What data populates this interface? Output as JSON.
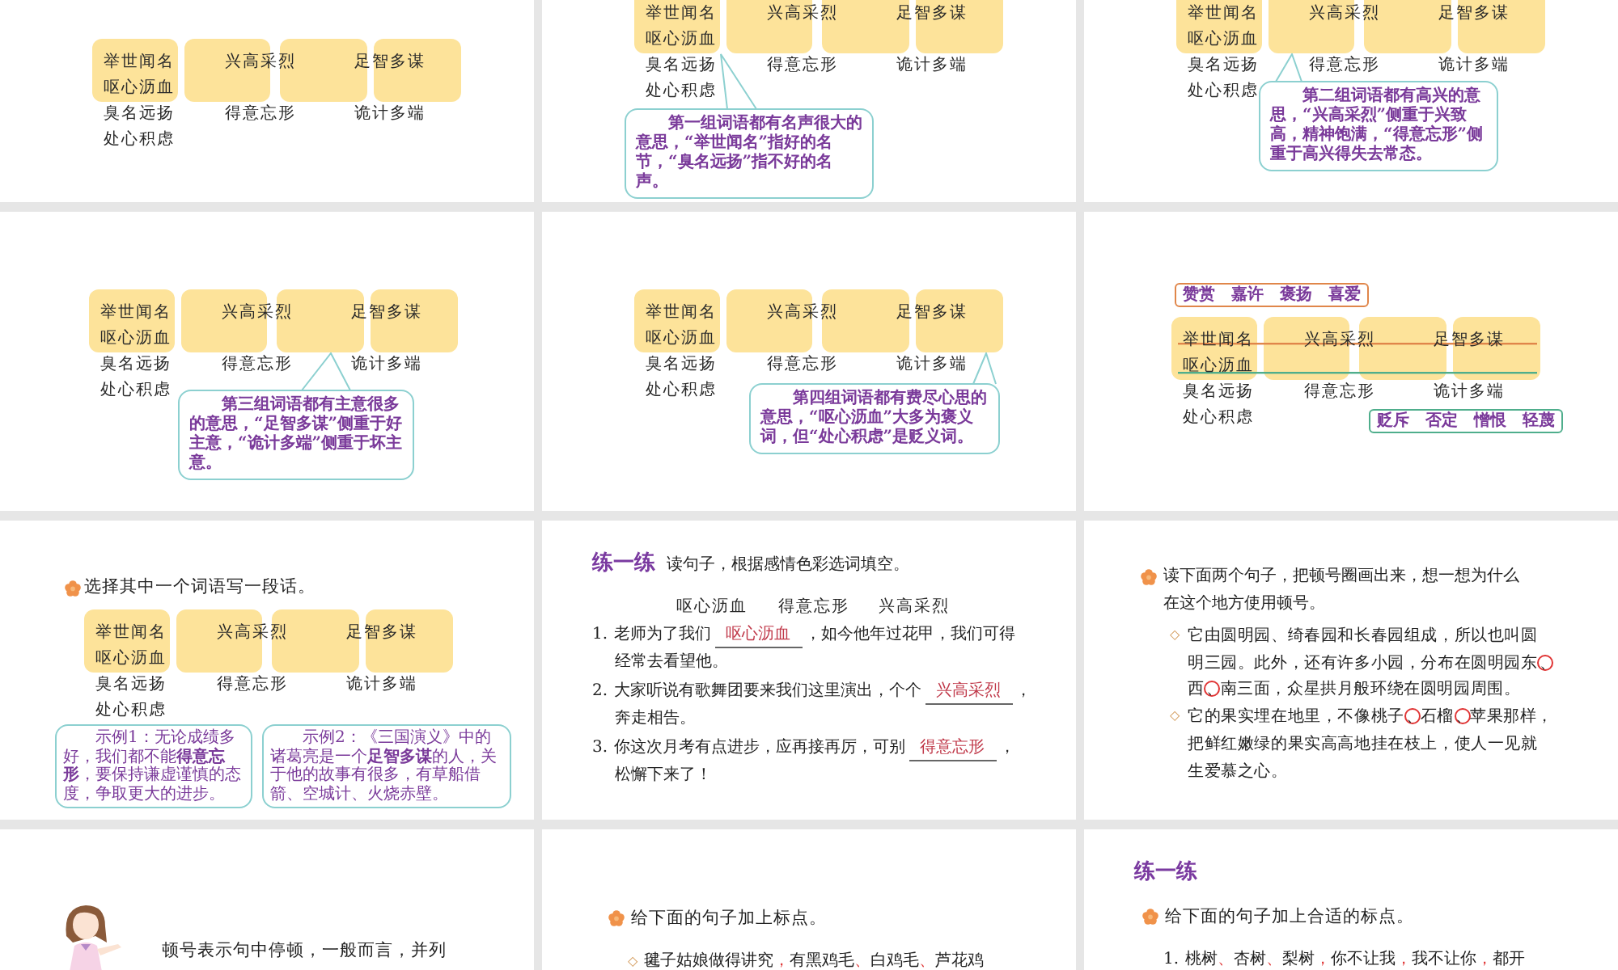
{
  "slides": [
    {
      "kind": "word-board",
      "board": {
        "rows": [
          [
            "举世闻名",
            "兴高采烈",
            "足智多谋"
          ],
          [
            "呕心沥血"
          ],
          [
            "臭名远扬",
            "得意忘形",
            "诡计多端"
          ],
          [
            "处心积虑"
          ]
        ]
      }
    },
    {
      "kind": "word-board",
      "board": {
        "rows": [
          [
            "举世闻名",
            "兴高采烈",
            "足智多谋"
          ],
          [
            "呕心沥血"
          ],
          [
            "臭名远扬",
            "得意忘形",
            "诡计多端"
          ],
          [
            "处心积虑"
          ]
        ]
      },
      "callout": {
        "text": "第一组词语都有名声很大的意思，“举世闻名”指好的名节，“臭名远扬”指不好的名声。"
      }
    },
    {
      "kind": "word-board",
      "board": {
        "rows": [
          [
            "举世闻名",
            "兴高采烈",
            "足智多谋"
          ],
          [
            "呕心沥血"
          ],
          [
            "臭名远扬",
            "得意忘形",
            "诡计多端"
          ],
          [
            "处心积虑"
          ]
        ]
      },
      "callout": {
        "text": "第二组词语都有高兴的意思，“兴高采烈”侧重于兴致高，精神饱满，“得意忘形”侧重于高兴得失去常态。"
      }
    },
    {
      "kind": "word-board",
      "board": {
        "rows": [
          [
            "举世闻名",
            "兴高采烈",
            "足智多谋"
          ],
          [
            "呕心沥血"
          ],
          [
            "臭名远扬",
            "得意忘形",
            "诡计多端"
          ],
          [
            "处心积虑"
          ]
        ]
      },
      "callout": {
        "text": "第三组词语都有主意很多的意思，“足智多谋”侧重于好主意，“诡计多端”侧重于坏主意。"
      }
    },
    {
      "kind": "word-board",
      "board": {
        "rows": [
          [
            "举世闻名",
            "兴高采烈",
            "足智多谋"
          ],
          [
            "呕心沥血"
          ],
          [
            "臭名远扬",
            "得意忘形",
            "诡计多端"
          ],
          [
            "处心积虑"
          ]
        ]
      },
      "callout": {
        "text": "第四组词语都有费尽心思的意思，“呕心沥血”大多为褒义词，但“处心积虑”是贬义词。"
      }
    },
    {
      "kind": "word-board",
      "tags": [
        {
          "text": "赞赏　嘉许　褒扬　喜爱",
          "color": "#e0864a"
        },
        {
          "text": "贬斥　否定　憎恨　轻蔑",
          "color": "#4fae8c"
        }
      ],
      "board": {
        "rows": [
          [
            "举世闻名",
            "兴高采烈",
            "足智多谋"
          ],
          [
            "呕心沥血"
          ],
          [
            "臭名远扬",
            "得意忘形",
            "诡计多端"
          ],
          [
            "处心积虑"
          ]
        ]
      }
    },
    {
      "kind": "word-board",
      "heading": "选择其中一个词语写一段话。",
      "board": {
        "rows": [
          [
            "举世闻名",
            "兴高采烈",
            "足智多谋"
          ],
          [
            "呕心沥血"
          ],
          [
            "臭名远扬",
            "得意忘形",
            "诡计多端"
          ],
          [
            "处心积虑"
          ]
        ]
      },
      "examples": [
        {
          "text": "示例1：无论成绩多好，我们都不能**得意忘形**，要保持谦虚谨慎的态度，争取更大的进步。"
        },
        {
          "text": "示例2：《三国演义》中的诸葛亮是一个**足智多谋**的人，关于他的故事有很多，有草船借箭、空城计、火烧赤壁。"
        }
      ]
    },
    {
      "kind": "fill-blanks",
      "title": "练一练",
      "instruction": "读句子，根据感情色彩选词填空。",
      "choices": [
        "呕心沥血",
        "得意忘形",
        "兴高采烈"
      ],
      "sentences": [
        {
          "number": "1.",
          "before": "老师为了我们",
          "answer": "呕心沥血",
          "after": "，如今他年过花甲，我们可得",
          "continuation": "经常去看望他。"
        },
        {
          "number": "2.",
          "before": "大家听说有歌舞团要来我们这里演出，个个",
          "answer": "兴高采烈",
          "after": "，",
          "continuation": "奔走相告。"
        },
        {
          "number": "3.",
          "before": "你这次月考有点进步，应再接再厉，可别",
          "answer": "得意忘形",
          "after": "，",
          "continuation": "松懈下来了！"
        }
      ]
    },
    {
      "kind": "circle-marks",
      "heading": "读下面两个句子，把顿号圈画出来，想一想为什么在这个地方使用顿号。",
      "items": [
        {
          "marker": "◇",
          "lines": [
            [
              {
                "text": "它由圆明园、绮春园和长春园组成，所以也叫圆",
                "circled": false
              }
            ],
            [
              {
                "text": "明三园。此外，还有许多小园，分布在圆明园东",
                "circled": false
              },
              {
                "text": "、",
                "circled": true
              }
            ],
            [
              {
                "text": "西",
                "circled": false
              },
              {
                "text": "、",
                "circled": true
              },
              {
                "text": "南三面，众星拱月般环绕在圆明园周围。",
                "circled": false
              }
            ]
          ]
        },
        {
          "marker": "◇",
          "lines": [
            [
              {
                "text": "它的果实埋在地里，不像桃子",
                "circled": false
              },
              {
                "text": "、",
                "circled": true
              },
              {
                "text": "石榴",
                "circled": false
              },
              {
                "text": "、",
                "circled": true
              },
              {
                "text": "苹果那样，",
                "circled": false
              }
            ],
            [
              {
                "text": "把鲜红嫩绿的果实高高地挂在枝上，使人一见就",
                "circled": false
              }
            ],
            [
              {
                "text": "生爱慕之心。",
                "circled": false
              }
            ]
          ]
        }
      ]
    },
    {
      "kind": "note",
      "text": "顿号表示句中停顿，一般而言，并列"
    },
    {
      "kind": "punctuation",
      "heading": "给下面的句子加上标点。",
      "items": [
        {
          "marker": "◇",
          "words": [
            {
              "word": "毽子姑娘做得讲究",
              "mark": "，"
            },
            {
              "word": "有黑鸡毛",
              "mark": "、"
            },
            {
              "word": "白鸡毛",
              "mark": "、"
            },
            {
              "word": "芦花鸡"
            }
          ]
        }
      ]
    },
    {
      "kind": "punctuation",
      "title": "练一练",
      "heading": "给下面的句子加上合适的标点。",
      "items": [
        {
          "marker": "1.",
          "words": [
            {
              "word": "桃树",
              "mark": "、"
            },
            {
              "word": "杏树",
              "mark": "、"
            },
            {
              "word": "梨树",
              "mark": "，"
            },
            {
              "word": "你不让我",
              "mark": "，"
            },
            {
              "word": "我不让你",
              "mark": "，"
            },
            {
              "word": "都开"
            }
          ]
        }
      ]
    }
  ]
}
